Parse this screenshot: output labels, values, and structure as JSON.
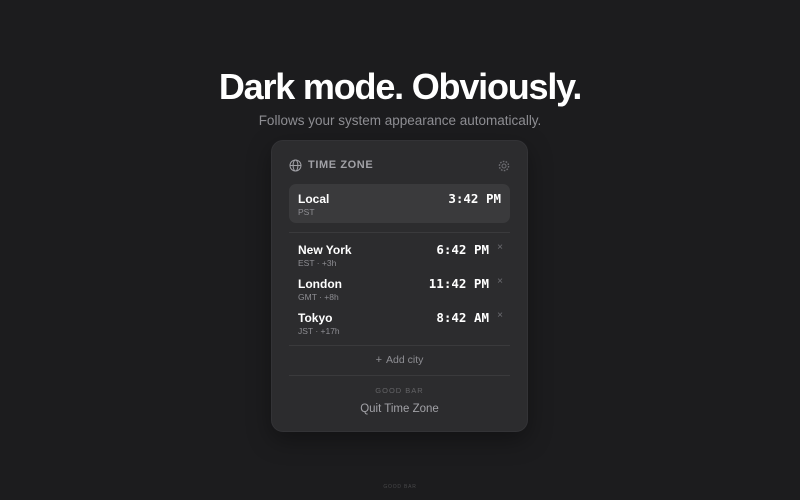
{
  "hero": {
    "headline": "Dark mode. Obviously.",
    "subhead": "Follows your system appearance automatically."
  },
  "panel": {
    "title": "TIME ZONE",
    "header_icon": "globe-icon",
    "settings_icon": "gear-icon",
    "local": {
      "city": "Local",
      "zone": "PST",
      "time": "3:42 PM"
    },
    "cities": [
      {
        "city": "New York",
        "zone": "EST · +3h",
        "time": "6:42 PM",
        "remove": "×"
      },
      {
        "city": "London",
        "zone": "GMT · +8h",
        "time": "11:42 PM",
        "remove": "×"
      },
      {
        "city": "Tokyo",
        "zone": "JST · +17h",
        "time": "8:42 AM",
        "remove": "×"
      }
    ],
    "add_city_symbol": "+",
    "add_city_label": "Add city",
    "brand": "GOOD BAR",
    "quit_label": "Quit Time Zone"
  },
  "footer": {
    "brand": "GOOD BAR"
  },
  "colors": {
    "background": "#1c1c1e",
    "panel": "#2c2c2e",
    "highlight": "#3a3a3c",
    "text_primary": "#ffffff",
    "text_secondary": "#8e8e93"
  }
}
